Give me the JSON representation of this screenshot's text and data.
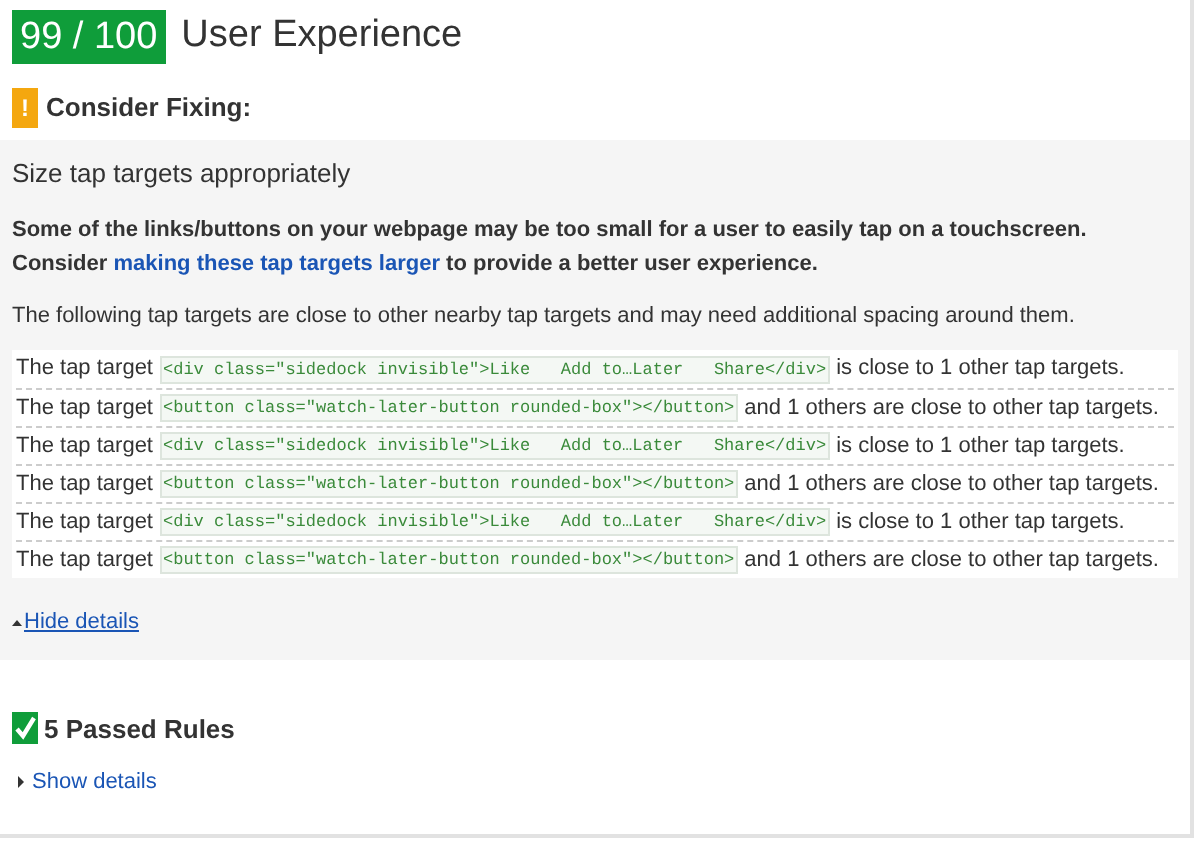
{
  "header": {
    "score": "99 / 100",
    "title": "User Experience"
  },
  "warning": {
    "icon": "!",
    "label": "Consider Fixing:"
  },
  "rule": {
    "title": "Size tap targets appropriately",
    "desc_before": "Some of the links/buttons on your webpage may be too small for a user to easily tap on a touchscreen. Consider",
    "link": "making these tap targets larger",
    "desc_after": "to provide a better user experience.",
    "intro": "The following tap targets are close to other nearby tap targets and may need additional spacing around them.",
    "rows": [
      {
        "prefix": "The tap target",
        "code": "<div class=\"sidedock invisible\">Like   Add to…Later   Share</div>",
        "suffix": "is close to 1 other tap targets."
      },
      {
        "prefix": "The tap target",
        "code": "<button class=\"watch-later-button rounded-box\"></button>",
        "suffix": "and 1 others are close to other tap targets."
      },
      {
        "prefix": "The tap target",
        "code": "<div class=\"sidedock invisible\">Like   Add to…Later   Share</div>",
        "suffix": "is close to 1 other tap targets."
      },
      {
        "prefix": "The tap target",
        "code": "<button class=\"watch-later-button rounded-box\"></button>",
        "suffix": "and 1 others are close to other tap targets."
      },
      {
        "prefix": "The tap target",
        "code": "<div class=\"sidedock invisible\">Like   Add to…Later   Share</div>",
        "suffix": "is close to 1 other tap targets."
      },
      {
        "prefix": "The tap target",
        "code": "<button class=\"watch-later-button rounded-box\"></button>",
        "suffix": "and 1 others are close to other tap targets."
      }
    ],
    "toggle": {
      "label": "Hide details",
      "expanded": true
    }
  },
  "passed": {
    "label": "5 Passed Rules",
    "toggle": {
      "label": "Show details",
      "expanded": false
    }
  }
}
